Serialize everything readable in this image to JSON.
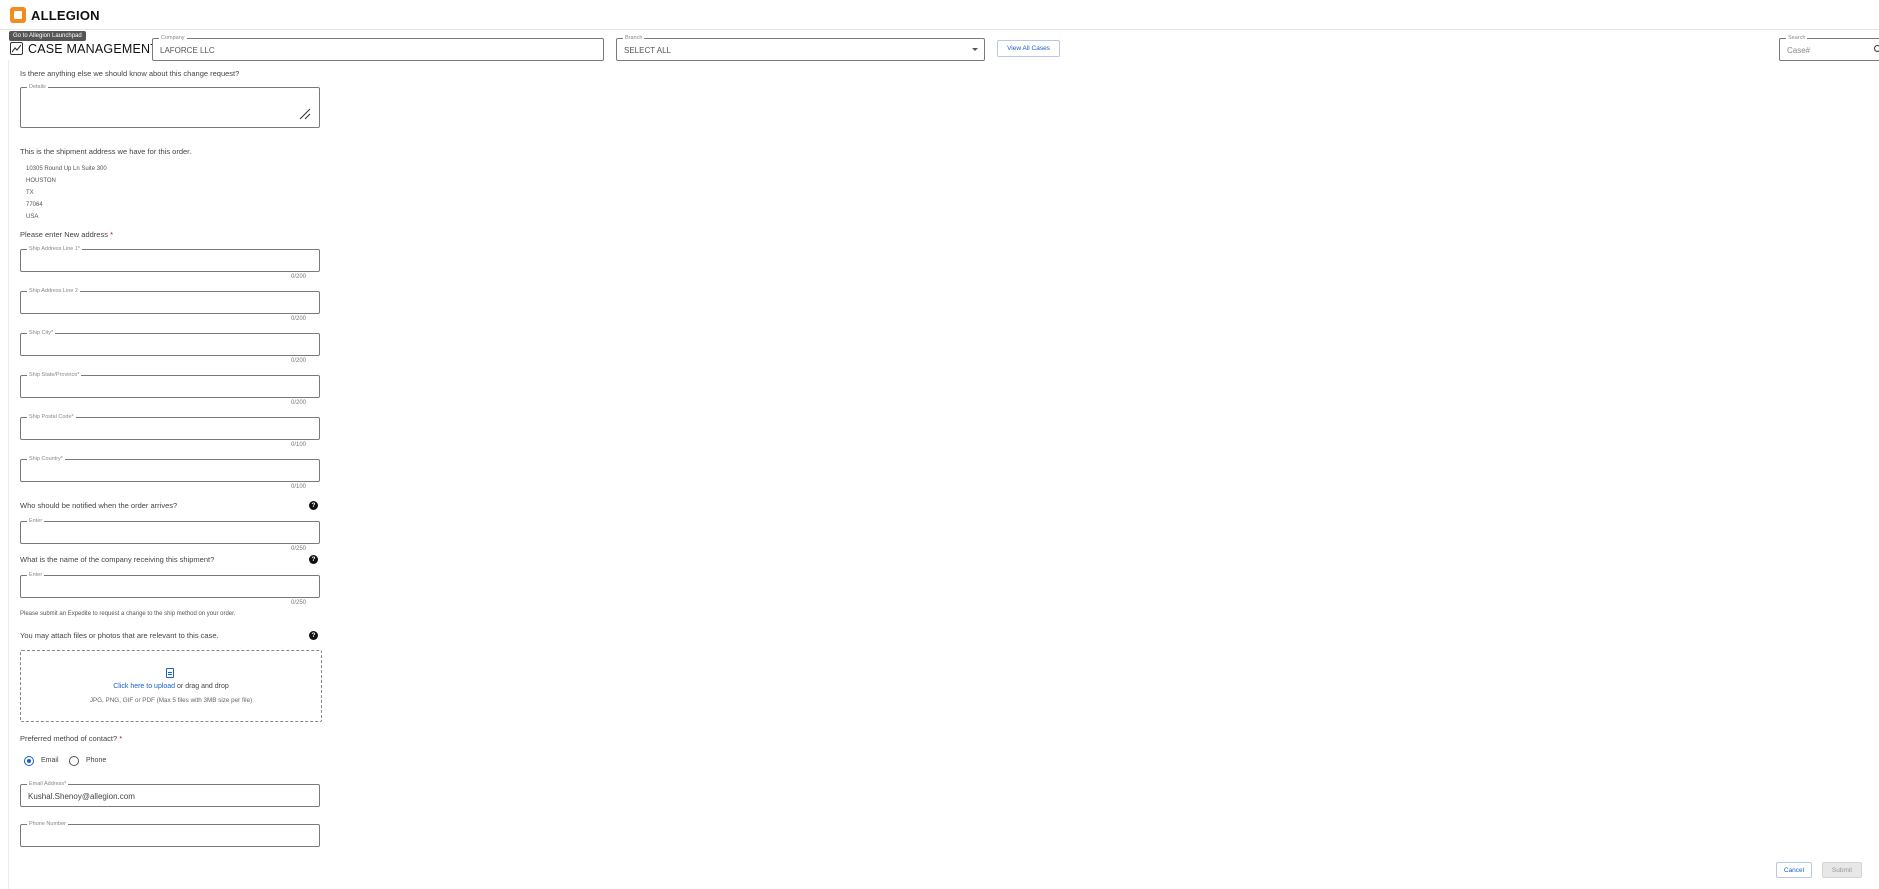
{
  "header": {
    "brand_name": "ALLEGION",
    "tooltip": "Go to Allegion Launchpad",
    "app_title": "CASE MANAGEMENT",
    "company": {
      "legend": "Company",
      "value": "LAFORCE LLC"
    },
    "branch": {
      "legend": "Branch",
      "value": "SELECT ALL"
    },
    "view_all_cases_label": "View All Cases",
    "search": {
      "legend": "Search",
      "placeholder": "Case#"
    }
  },
  "form": {
    "anything_else_question": "Is there anything else we should know about this change request?",
    "details_legend": "Details",
    "shipment_address_intro": "This is the shipment address we have for this order.",
    "current_address": {
      "line1": "10305 Round Up Ln Suite 300",
      "city": "HOUSTON",
      "state": "TX",
      "postal": "77064",
      "country": "USA"
    },
    "new_address_label": "Please enter New address",
    "required_mark": "*",
    "fields": [
      {
        "legend": "Ship Address Line 1*",
        "counter": "0/200"
      },
      {
        "legend": "Ship Address Line 2",
        "counter": "0/200"
      },
      {
        "legend": "Ship City*",
        "counter": "0/200"
      },
      {
        "legend": "Ship State/Province*",
        "counter": "0/200"
      },
      {
        "legend": "Ship Postal Code*",
        "counter": "0/100"
      },
      {
        "legend": "Ship Country*",
        "counter": "0/100"
      }
    ],
    "notify_question": "Who should be notified when the order arrives?",
    "notify_field": {
      "legend": "Enter",
      "counter": "0/250"
    },
    "company_question": "What is the name of the company receiving this shipment?",
    "company_field": {
      "legend": "Enter",
      "counter": "0/250"
    },
    "expedite_note": "Please submit an Expedite to request a change to the ship method on your order.",
    "attach_question": "You may attach files or photos that are relevant to this case.",
    "upload": {
      "link_text": "Click here to upload",
      "rest_text": " or drag and drop",
      "hint": "JPG, PNG, GIF or PDF (Max 5 files with 3MB size per file)"
    },
    "contact_question": "Preferred method of contact?",
    "contact_options": [
      {
        "label": "Email",
        "checked": true
      },
      {
        "label": "Phone",
        "checked": false
      }
    ],
    "email_field": {
      "legend": "Email Address*",
      "value": "Kushal.Shenoy@allegion.com"
    },
    "phone_field": {
      "legend": "Phone Number"
    },
    "help_icon_glyph": "?"
  },
  "footer": {
    "cancel_label": "Cancel",
    "submit_label": "Submit"
  },
  "colors": {
    "accent": "#1a5fc8",
    "brand": "#f28c1e",
    "required": "#d0021b"
  }
}
